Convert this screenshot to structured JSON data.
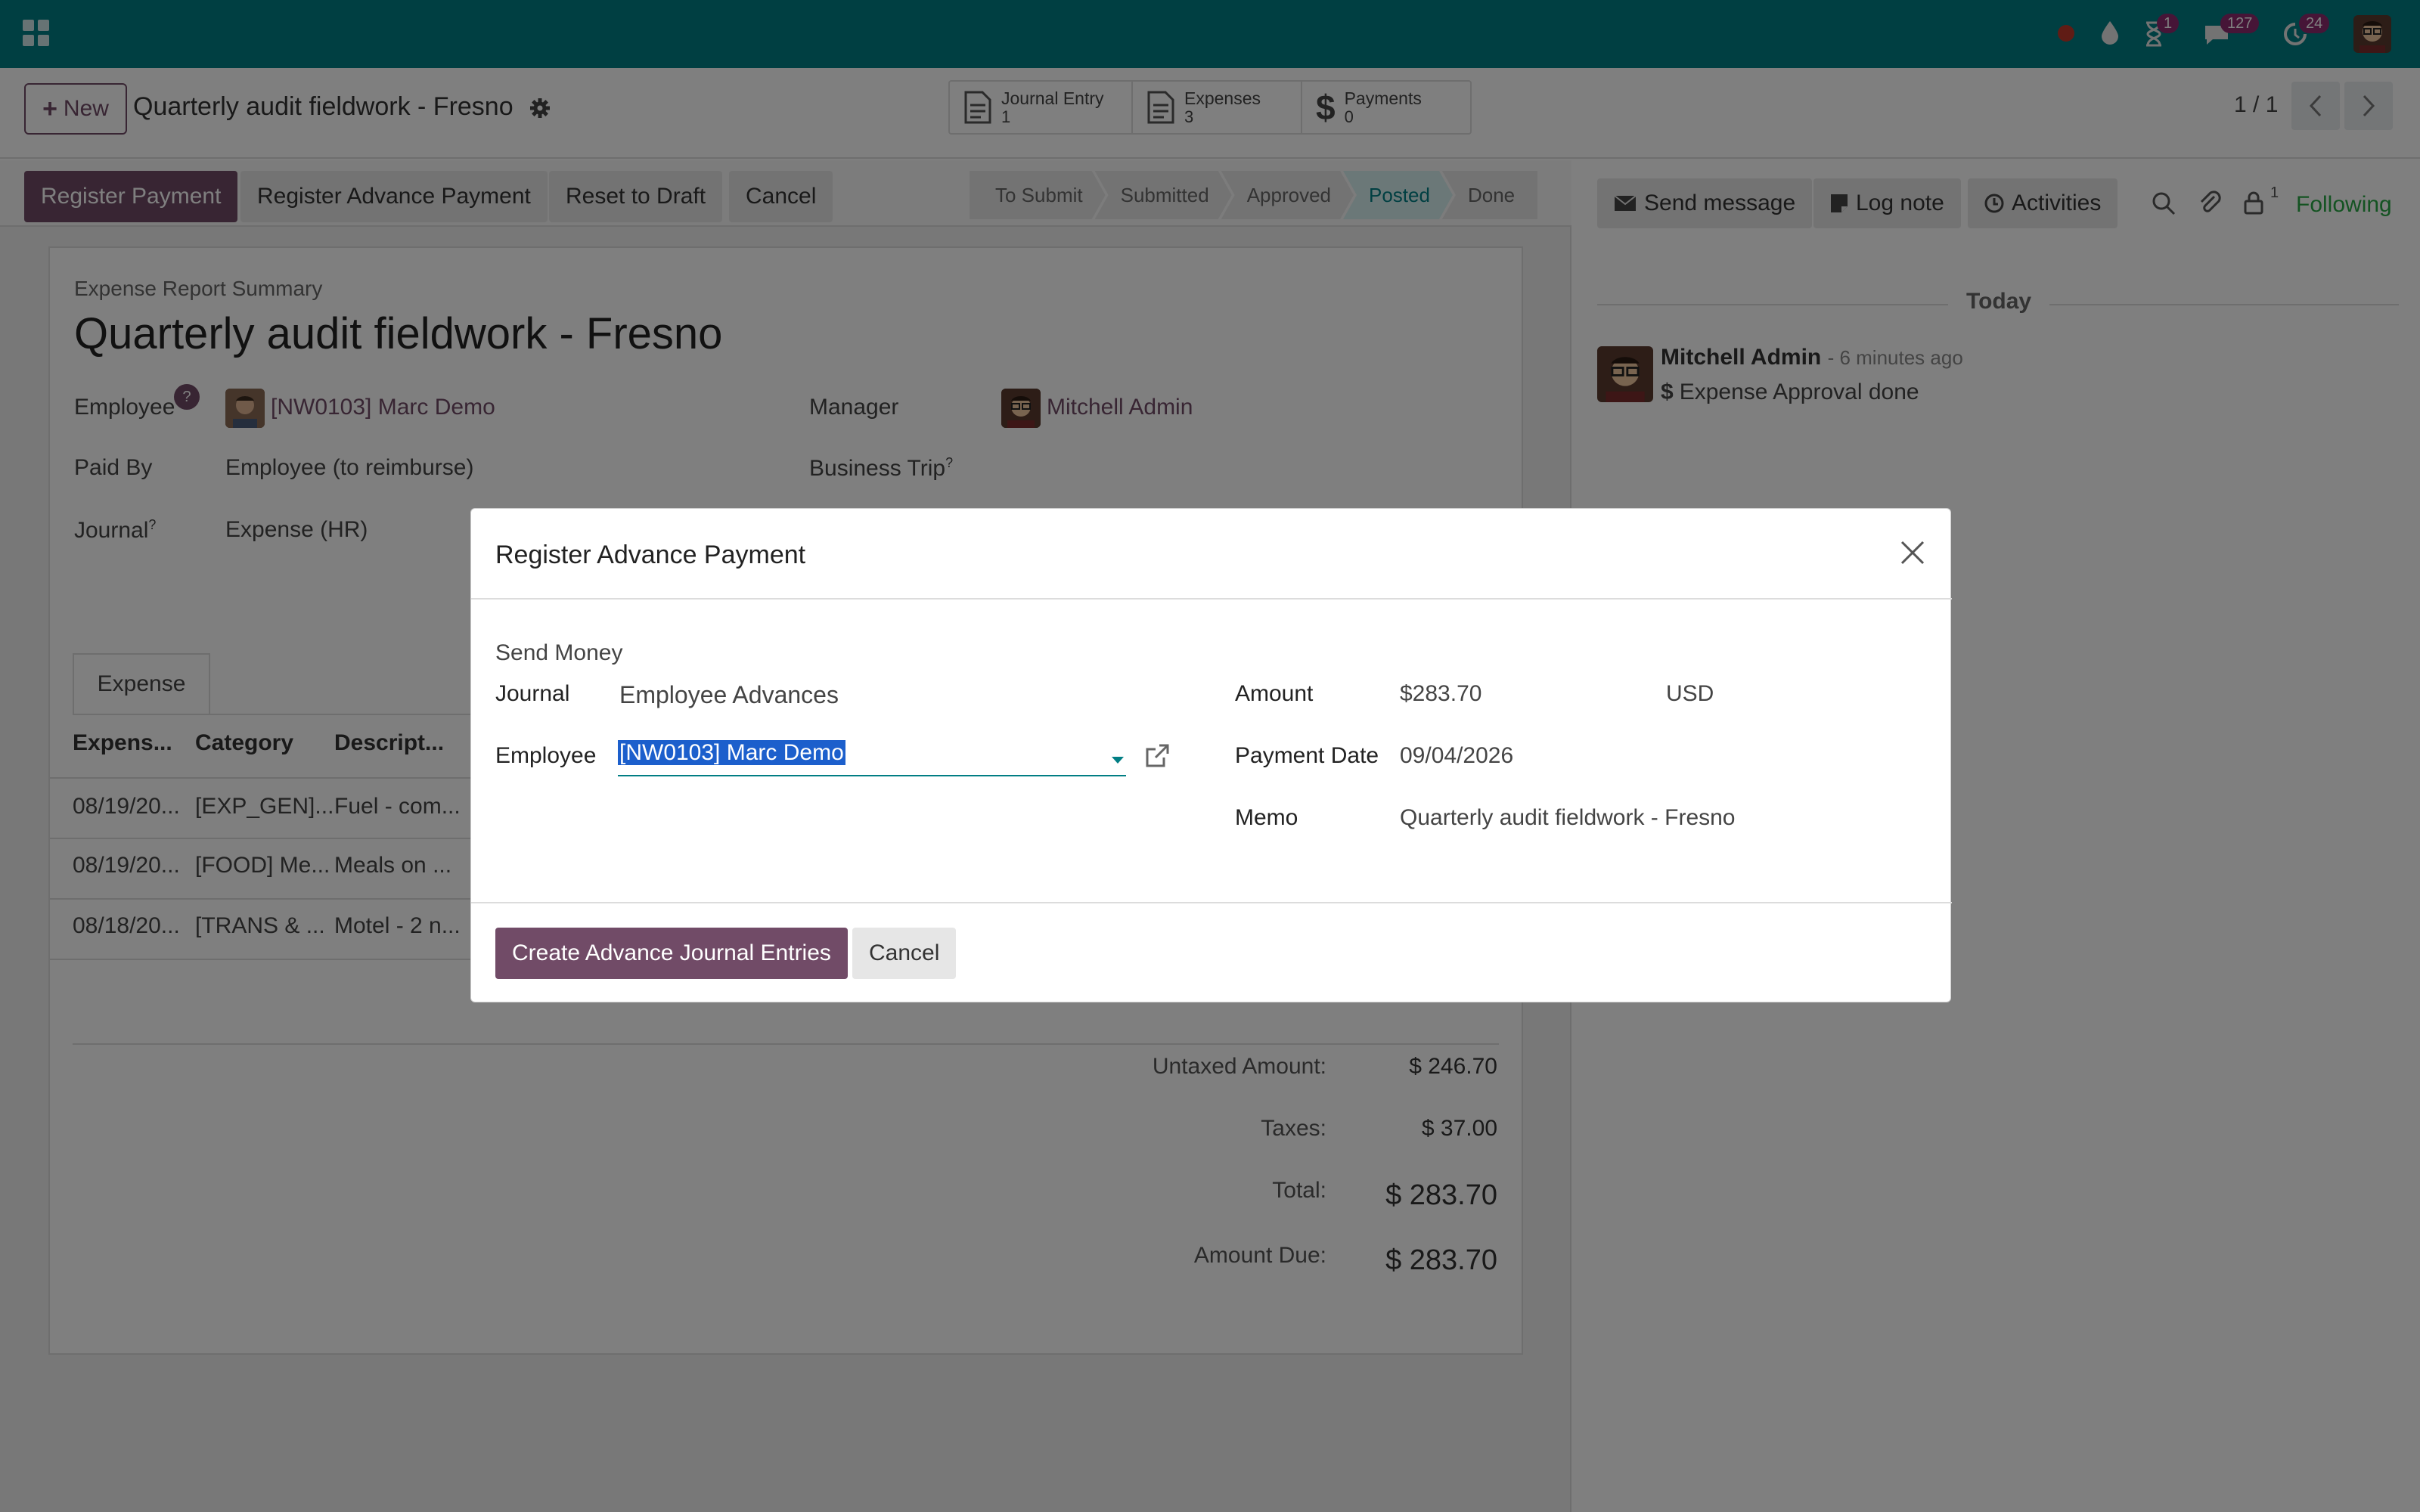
{
  "navbar": {
    "app_menu_icon": "grid-icon",
    "badges": {
      "activities": "1",
      "messages": "127",
      "updates": "24"
    },
    "colors": {
      "bar": "#017e84",
      "badge": "#8d2b6f"
    }
  },
  "control": {
    "new_label": "New",
    "breadcrumb": "Quarterly audit fieldwork - Fresno",
    "smart_buttons": [
      {
        "label": "Journal Entry",
        "value": "1",
        "icon": "document-icon"
      },
      {
        "label": "Expenses",
        "value": "3",
        "icon": "document-icon"
      },
      {
        "label": "Payments",
        "value": "0",
        "icon": "dollar-icon"
      }
    ],
    "pager": "1 / 1"
  },
  "header": {
    "buttons": [
      "Register Payment",
      "Register Advance Payment",
      "Reset to Draft",
      "Cancel"
    ],
    "stages": [
      "To Submit",
      "Submitted",
      "Approved",
      "Posted",
      "Done"
    ],
    "active_stage": "Posted"
  },
  "sheet": {
    "subtitle": "Expense Report Summary",
    "title": "Quarterly audit fieldwork - Fresno",
    "employee_label": "Employee",
    "employee_help": "?",
    "employee_value": "[NW0103] Marc Demo",
    "paid_by_label": "Paid By",
    "paid_by_value": "Employee (to reimburse)",
    "journal_label": "Journal",
    "journal_value": "Expense (HR)",
    "manager_label": "Manager",
    "manager_value": "Mitchell Admin",
    "business_trip_label": "Business Trip",
    "help_mark": "?",
    "tab": "Expense",
    "columns": [
      "Expens...",
      "Category",
      "Descript..."
    ],
    "rows": [
      [
        "08/19/20...",
        "[EXP_GEN]...",
        "Fuel - com..."
      ],
      [
        "08/19/20...",
        "[FOOD] Me...",
        "Meals on ..."
      ],
      [
        "08/18/20...",
        "[TRANS & ...",
        "Motel - 2 n..."
      ]
    ],
    "totals": [
      {
        "label": "Untaxed Amount:",
        "value": "$ 246.70"
      },
      {
        "label": "Taxes:",
        "value": "$ 37.00"
      },
      {
        "label": "Total:",
        "value": "$ 283.70"
      },
      {
        "label": "Amount Due:",
        "value": "$ 283.70"
      }
    ]
  },
  "chatter": {
    "send_message": "Send message",
    "log_note": "Log note",
    "activities": "Activities",
    "followers_count": "1",
    "following": "Following",
    "date_separator": "Today",
    "message_author": "Mitchell Admin",
    "message_time": "- 6 minutes ago",
    "message_body": "Expense Approval done"
  },
  "modal": {
    "title": "Register Advance Payment",
    "section": "Send Money",
    "journal_label": "Journal",
    "journal_value": "Employee Advances",
    "employee_label": "Employee",
    "employee_value": "[NW0103] Marc Demo",
    "amount_label": "Amount",
    "amount_value": "$283.70",
    "currency": "USD",
    "payment_date_label": "Payment Date",
    "payment_date_value": "09/04/2026",
    "memo_label": "Memo",
    "memo_value": "Quarterly audit fieldwork - Fresno",
    "create_button": "Create Advance Journal Entries",
    "cancel_button": "Cancel",
    "colors": {
      "primary": "#714b67",
      "accent": "#017e84"
    }
  }
}
